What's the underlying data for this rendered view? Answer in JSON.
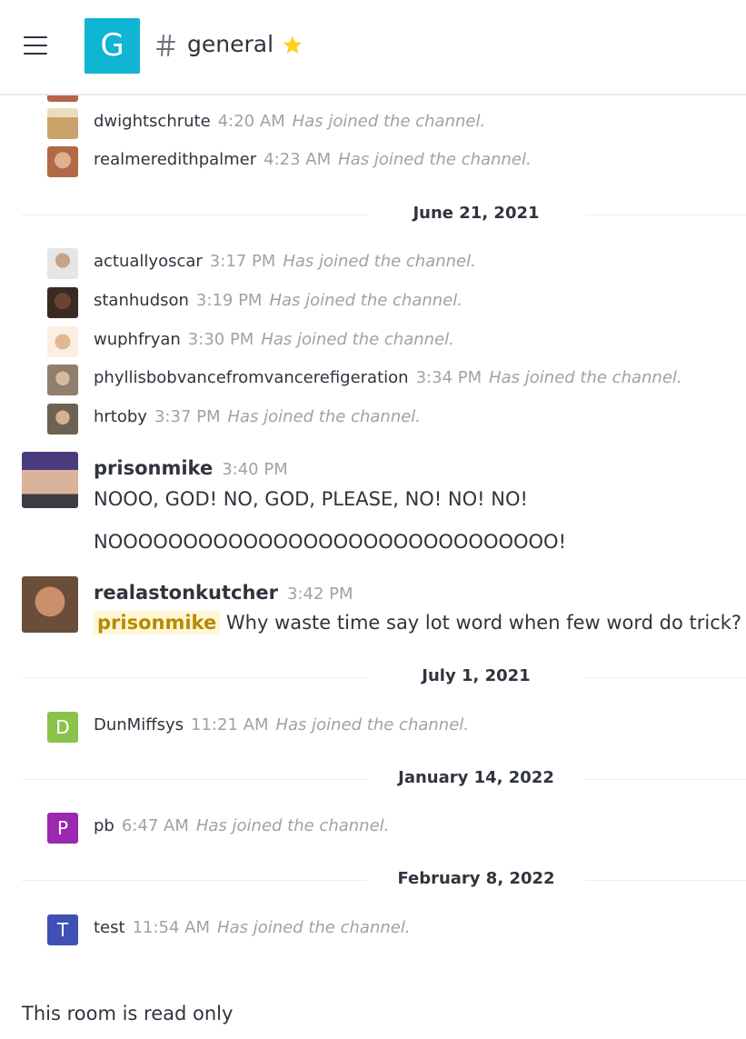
{
  "header": {
    "room_initial": "G",
    "room_name": "general",
    "room_avatar_color": "#0fb5d2",
    "star_color": "#ffd21f",
    "icons": [
      "menu-icon",
      "hash-icon",
      "star-icon"
    ]
  },
  "timeline": {
    "partial_top": {
      "avatar_color": "#b5654a"
    },
    "group1": [
      {
        "user": "dwightschrute",
        "time": "4:20 AM",
        "note": "Has joined the channel.",
        "avatar_color": "#c9a36a"
      },
      {
        "user": "realmeredithpalmer",
        "time": "4:23 AM",
        "note": "Has joined the channel.",
        "avatar_color": "#b06a45"
      }
    ],
    "date1": "June 21, 2021",
    "group2": [
      {
        "user": "actuallyoscar",
        "time": "3:17 PM",
        "note": "Has joined the channel.",
        "avatar_color": "#7d8089"
      },
      {
        "user": "stanhudson",
        "time": "3:19 PM",
        "note": "Has joined the channel.",
        "avatar_color": "#5a3a2a"
      },
      {
        "user": "wuphfryan",
        "time": "3:30 PM",
        "note": "Has joined the channel.",
        "avatar_color": "#d9b08c"
      },
      {
        "user": "phyllisbobvancefromvancerefigeration",
        "time": "3:34 PM",
        "note": "Has joined the channel.",
        "avatar_color": "#a08f7a"
      },
      {
        "user": "hrtoby",
        "time": "3:37 PM",
        "note": "Has joined the channel.",
        "avatar_color": "#8a7a66"
      }
    ],
    "msg1": {
      "user": "prisonmike",
      "time": "3:40 PM",
      "line1": "NOOO, GOD! NO, GOD, PLEASE, NO! NO! NO!",
      "line2": "NOOOOOOOOOOOOOOOOOOOOOOOOOOOOOO!",
      "avatar_color": "#5a4a8a"
    },
    "msg2": {
      "user": "realastonkutcher",
      "time": "3:42 PM",
      "mention": "prisonmike",
      "text": "Why waste time say lot word when few word do trick?",
      "avatar_color": "#8a6a50"
    },
    "date2": "July 1, 2021",
    "group3": [
      {
        "user": "DunMiffsys",
        "time": "11:21 AM",
        "note": "Has joined the channel.",
        "initial": "D",
        "avatar_color": "#8bc34a"
      }
    ],
    "date3": "January 14, 2022",
    "group4": [
      {
        "user": "pb",
        "time": "6:47 AM",
        "note": "Has joined the channel.",
        "initial": "P",
        "avatar_color": "#9c27b0"
      }
    ],
    "date4": "February 8, 2022",
    "group5": [
      {
        "user": "test",
        "time": "11:54 AM",
        "note": "Has joined the channel.",
        "initial": "T",
        "avatar_color": "#3f51b5"
      }
    ]
  },
  "footer": {
    "readonly_text": "This room is read only"
  }
}
